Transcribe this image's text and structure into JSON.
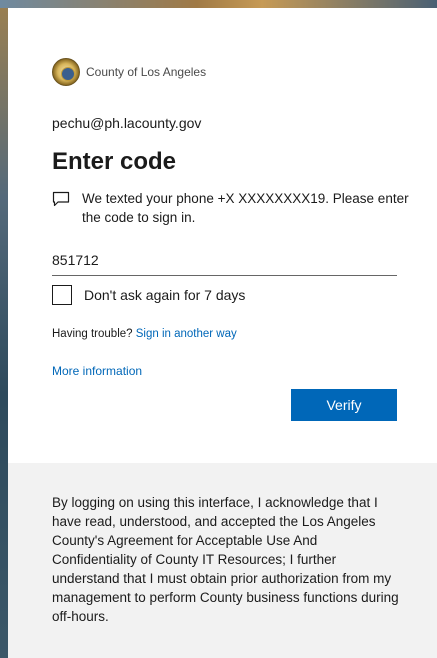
{
  "header": {
    "org_name": "County of Los Angeles",
    "logo": "la-county-seal-icon"
  },
  "account": {
    "email": "pechu@ph.lacounty.gov"
  },
  "page": {
    "title": "Enter code",
    "sms_message": "We texted your phone +X XXXXXXXX19. Please enter the code to sign in.",
    "sms_icon": "message-bubble-icon"
  },
  "form": {
    "code_value": "851712",
    "remember_label": "Don't ask again for 7 days",
    "remember_checked": false,
    "trouble_prefix": "Having trouble?",
    "trouble_link": "Sign in another way",
    "more_info": "More information",
    "verify_label": "Verify"
  },
  "footer": {
    "text": "By logging on using this interface, I acknowledge that I have read, understood, and accepted the Los Angeles County's Agreement for Acceptable Use And Confidentiality of County IT Resources; I further understand that I must obtain prior authorization from my management to perform County business functions during off-hours."
  },
  "colors": {
    "accent": "#0067b8",
    "footer_bg": "#f2f2f2"
  }
}
